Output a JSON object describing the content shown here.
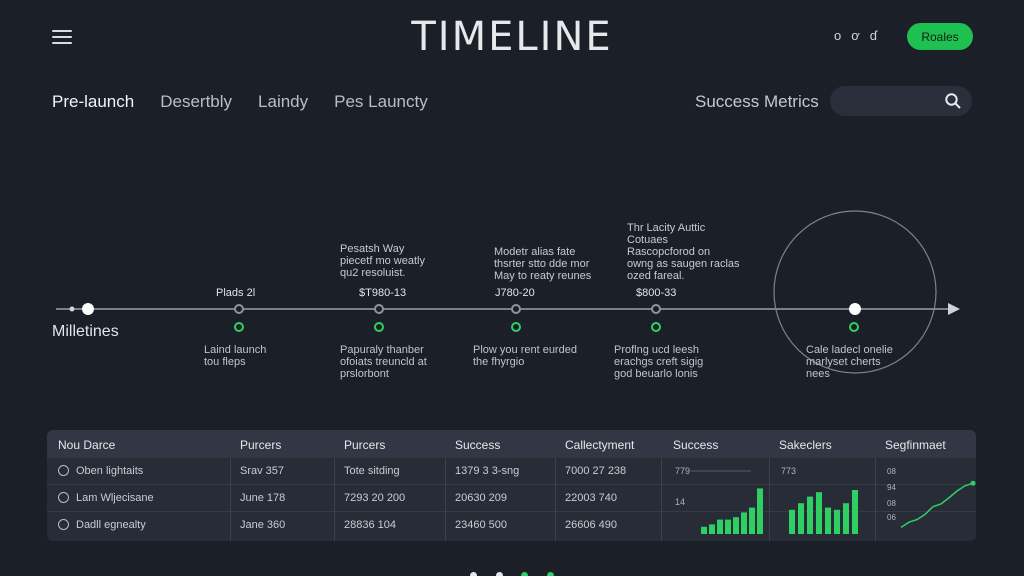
{
  "header": {
    "title": "TIMELINE",
    "icons": [
      "o",
      "ơ",
      "ɗ"
    ],
    "button_label": "Roales"
  },
  "tabs": [
    {
      "label": "Pre-launch",
      "active": true
    },
    {
      "label": "Desertbly",
      "active": false
    },
    {
      "label": "Laindy",
      "active": false
    },
    {
      "label": "Pes Launcty",
      "active": false
    }
  ],
  "metrics": {
    "label": "Success Metrics",
    "search_value": "",
    "search_placeholder": ""
  },
  "timeline": {
    "label": "Milletines",
    "milestones": [
      {
        "event": "",
        "date": "Plads 2l",
        "desc": "Laind launch\ntou fleps"
      },
      {
        "event": "Pesatsh Way\npiecetf mo weatly\nqu2 resoluist.",
        "date": "$T980-13",
        "desc": "Papuraly thanber\nofoiats treuncld at\nprslorbont"
      },
      {
        "event": "Modetr alias fate\nthsrter stto dde mor\nMay to reaty reunes",
        "date": "J780-20",
        "desc": "Plow you rent eurded\nthe fhyrgio"
      },
      {
        "event": "Thr Lacity Auttic\nCotuaes\nRascopcforod on\nowng as saugen raclas\nozed fareal.",
        "date": "$800-33",
        "desc": "Proflng ucd leesh\nerachgs creft sigig\ngod beuarlo lonis"
      },
      {
        "event": "",
        "date": "",
        "desc": "Cale ladecl onelie\nmarlyset cherts\nnees"
      }
    ]
  },
  "table": {
    "columns": [
      "Nou Darce",
      "Purcers",
      "Purcers",
      "Success",
      "Callectyment",
      "Success",
      "Sakeclers",
      "Segfinmaet"
    ],
    "rows": [
      [
        "Oben lightaits",
        "Srav 357",
        "Tote sitding",
        "1379 3 3-sng",
        "7000 27 238"
      ],
      [
        "Lam Wljecisane",
        "June 178",
        "7293 20 200",
        "20630 209",
        "22003 740"
      ],
      [
        "Dadll egnealty",
        "Jane 360",
        "28836 104",
        "23460 500",
        "26606 490"
      ]
    ],
    "chart1": {
      "labels": [
        "779",
        "14"
      ],
      "values": [
        0.15,
        0.2,
        0.3,
        0.3,
        0.35,
        0.45,
        0.55,
        0.95
      ]
    },
    "chart2": {
      "labels": [
        "773"
      ],
      "values": [
        0.55,
        0.7,
        0.85,
        0.95,
        0.6,
        0.55,
        0.7,
        1.0
      ]
    },
    "chart3": {
      "labels": [
        "08",
        "94",
        "08",
        "06"
      ],
      "values": [
        0.05,
        0.15,
        0.2,
        0.3,
        0.45,
        0.5,
        0.62,
        0.75,
        0.85,
        0.9
      ]
    },
    "accent": "#2fcf63"
  },
  "pager": {
    "dots": [
      "#e6e8ec",
      "#e6e8ec",
      "#2fcf63",
      "#2fcf63"
    ]
  }
}
